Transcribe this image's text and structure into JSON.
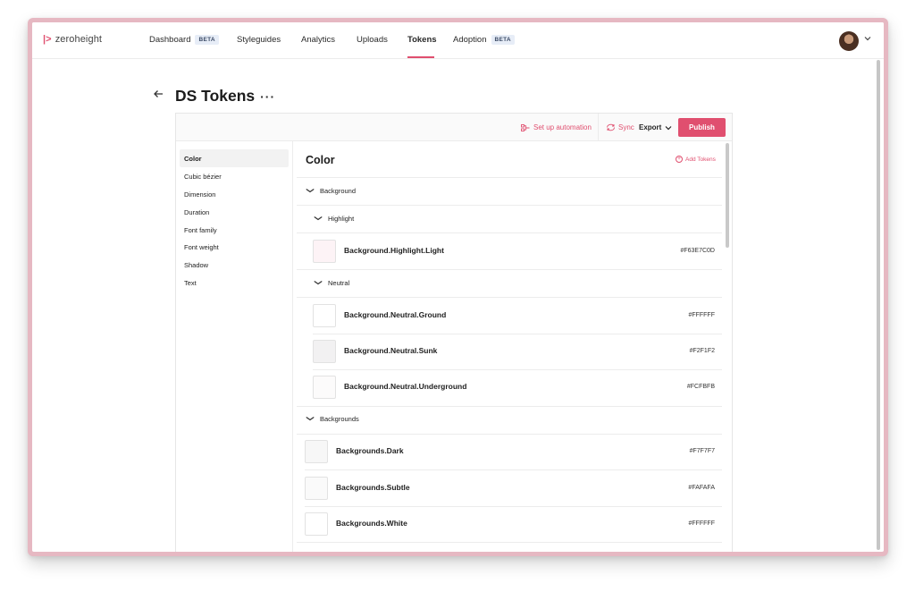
{
  "app": {
    "logo_text": "zeroheight"
  },
  "nav": {
    "items": [
      {
        "label": "Dashboard",
        "badge": "BETA"
      },
      {
        "label": "Styleguides"
      },
      {
        "label": "Analytics"
      },
      {
        "label": "Uploads"
      },
      {
        "label": "Tokens",
        "active": true
      },
      {
        "label": "Adoption",
        "badge": "BETA"
      }
    ]
  },
  "page": {
    "title": "DS Tokens",
    "more_glyph": "···"
  },
  "toolbar": {
    "automation_label": "Set up automation",
    "sync_label": "Sync",
    "export_label": "Export",
    "publish_label": "Publish"
  },
  "sidebar": {
    "items": [
      "Color",
      "Cubic bézier",
      "Dimension",
      "Duration",
      "Font family",
      "Font weight",
      "Shadow",
      "Text"
    ],
    "active": "Color"
  },
  "content": {
    "title": "Color",
    "add_tokens_label": "Add Tokens",
    "groups": [
      {
        "label": "Background"
      },
      {
        "label": "Highlight"
      },
      {
        "label": "Neutral"
      },
      {
        "label": "Backgrounds"
      }
    ],
    "tokens": [
      {
        "name": "Background.Highlight.Light",
        "value": "#F63E7C0D",
        "swatch": "#fdf3f6"
      },
      {
        "name": "Background.Neutral.Ground",
        "value": "#FFFFFF",
        "swatch": "#FFFFFF"
      },
      {
        "name": "Background.Neutral.Sunk",
        "value": "#F2F1F2",
        "swatch": "#F2F1F2"
      },
      {
        "name": "Background.Neutral.Underground",
        "value": "#FCFBFB",
        "swatch": "#FCFBFB"
      },
      {
        "name": "Backgrounds.Dark",
        "value": "#F7F7F7",
        "swatch": "#F7F7F7"
      },
      {
        "name": "Backgrounds.Subtle",
        "value": "#FAFAFA",
        "swatch": "#FAFAFA"
      },
      {
        "name": "Backgrounds.White",
        "value": "#FFFFFF",
        "swatch": "#FFFFFF"
      }
    ]
  },
  "colors": {
    "accent": "#E04F6F",
    "badge_bg": "#E7EDF7"
  },
  "icons": [
    "logo-mark-icon",
    "back-arrow-icon",
    "more-icon",
    "automation-icon",
    "sync-icon",
    "chevron-down-icon",
    "add-circle-icon",
    "avatar"
  ]
}
